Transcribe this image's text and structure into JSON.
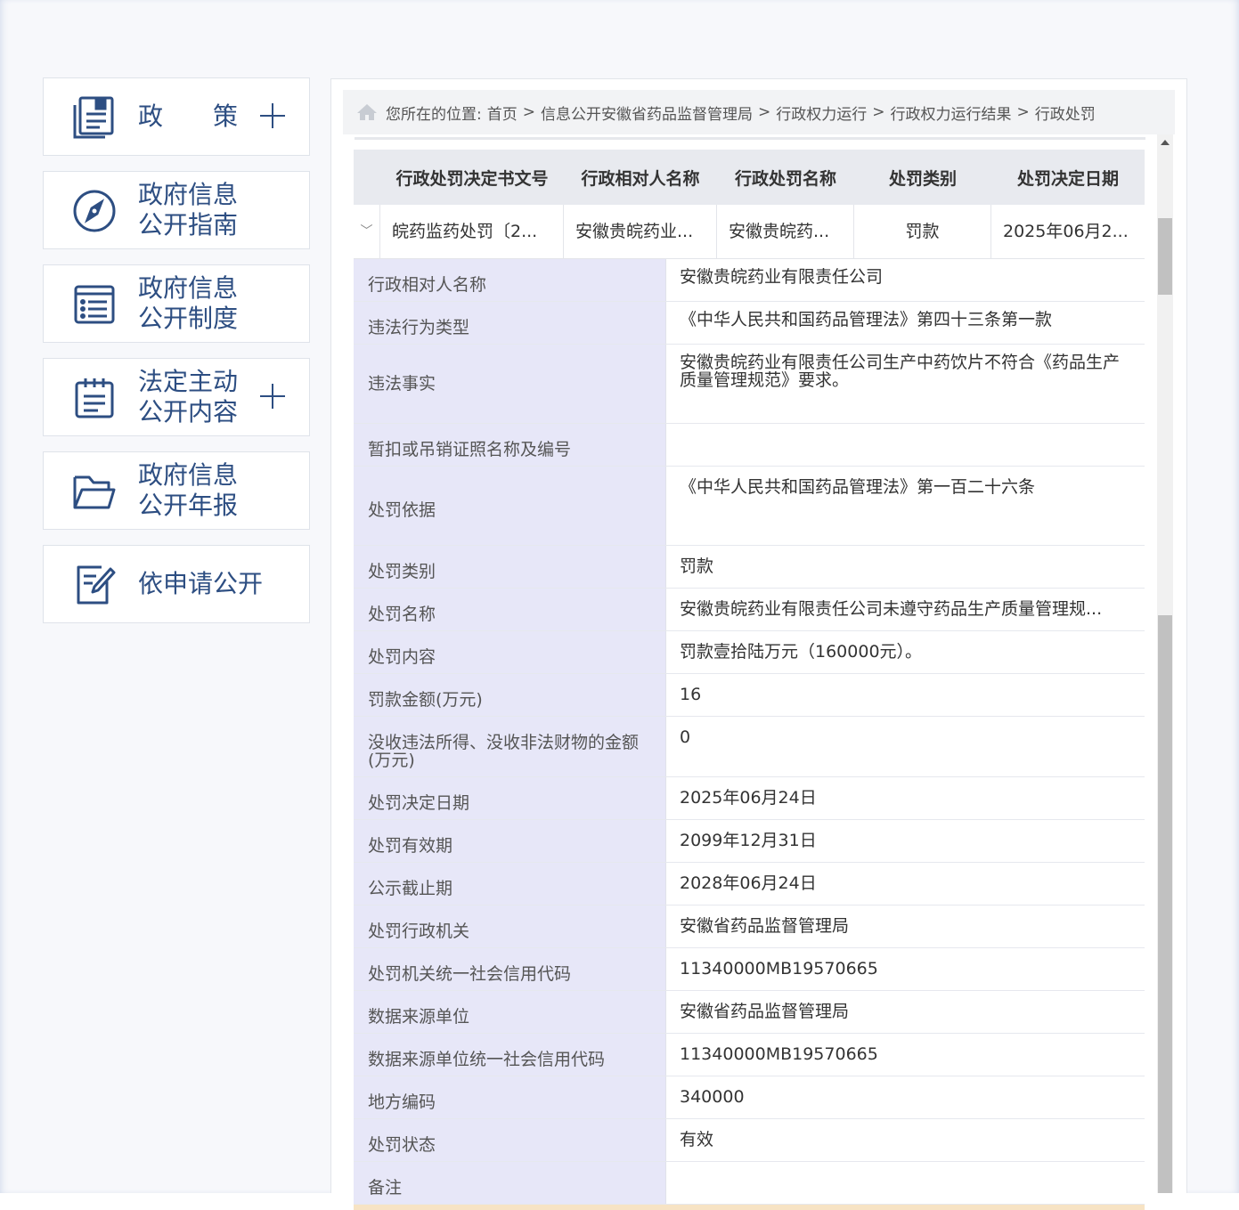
{
  "sidebar": {
    "items": [
      {
        "label": "政　　策",
        "icon": "document-stack-icon",
        "expandable": true
      },
      {
        "label": "政府信息\n公开指南",
        "icon": "compass-icon",
        "expandable": false
      },
      {
        "label": "政府信息\n公开制度",
        "icon": "list-document-icon",
        "expandable": false
      },
      {
        "label": "法定主动\n公开内容",
        "icon": "clipboard-icon",
        "expandable": true
      },
      {
        "label": "政府信息\n公开年报",
        "icon": "folder-icon",
        "expandable": false
      },
      {
        "label": "依申请公开",
        "icon": "edit-document-icon",
        "expandable": false
      }
    ]
  },
  "breadcrumb": {
    "prefix": "您所在的位置:",
    "items": [
      "首页",
      "信息公开安徽省药品监督管理局",
      "行政权力运行",
      "行政权力运行结果",
      "行政处罚"
    ],
    "separator": ">"
  },
  "table": {
    "headers": [
      "行政处罚决定书文号",
      "行政相对人名称",
      "行政处罚名称",
      "处罚类别",
      "处罚决定日期"
    ],
    "row": [
      "皖药监药处罚〔2...",
      "安徽贵皖药业...",
      "安徽贵皖药...",
      "罚款",
      "2025年06月2..."
    ]
  },
  "detail": [
    {
      "label": "行政相对人名称",
      "value": "安徽贵皖药业有限责任公司"
    },
    {
      "label": "违法行为类型",
      "value": "《中华人民共和国药品管理法》第四十三条第一款"
    },
    {
      "label": "违法事实",
      "value": "安徽贵皖药业有限责任公司生产中药饮片不符合《药品生产质量管理规范》要求。"
    },
    {
      "label": "暂扣或吊销证照名称及编号",
      "value": ""
    },
    {
      "label": "处罚依据",
      "value": "《中华人民共和国药品管理法》第一百二十六条"
    },
    {
      "label": "处罚类别",
      "value": "罚款"
    },
    {
      "label": "处罚名称",
      "value": "安徽贵皖药业有限责任公司未遵守药品生产质量管理规..."
    },
    {
      "label": "处罚内容",
      "value": "罚款壹拾陆万元（160000元）。"
    },
    {
      "label": "罚款金额(万元)",
      "value": "16"
    },
    {
      "label": "没收违法所得、没收非法财物的金额(万元)",
      "value": "0"
    },
    {
      "label": "处罚决定日期",
      "value": "2025年06月24日"
    },
    {
      "label": "处罚有效期",
      "value": "2099年12月31日"
    },
    {
      "label": "公示截止期",
      "value": "2028年06月24日"
    },
    {
      "label": "处罚行政机关",
      "value": "安徽省药品监督管理局"
    },
    {
      "label": "处罚机关统一社会信用代码",
      "value": "11340000MB19570665"
    },
    {
      "label": "数据来源单位",
      "value": "安徽省药品监督管理局"
    },
    {
      "label": "数据来源单位统一社会信用代码",
      "value": "11340000MB19570665"
    },
    {
      "label": "地方编码",
      "value": "340000"
    },
    {
      "label": "处罚状态",
      "value": "有效"
    },
    {
      "label": "备注",
      "value": ""
    }
  ],
  "colors": {
    "brand": "#2d4e82",
    "label_bg": "#e7e7f8",
    "header_bg": "#e8eaef"
  }
}
